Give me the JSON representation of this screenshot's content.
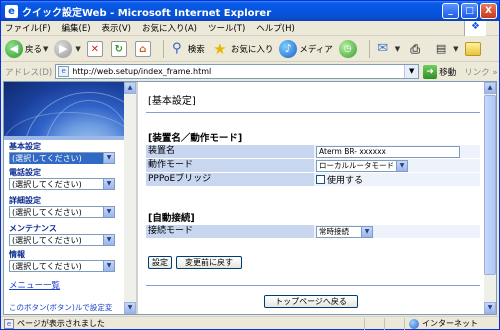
{
  "window": {
    "title": "クイック設定Web - Microsoft Internet Explorer",
    "buttons": {
      "minimize": "_",
      "maximize": "□",
      "close": "X"
    }
  },
  "menubar": {
    "items": [
      "ファイル(F)",
      "編集(E)",
      "表示(V)",
      "お気に入り(A)",
      "ツール(T)",
      "ヘルプ(H)"
    ]
  },
  "toolbar": {
    "back_label": "戻る",
    "search_label": "検索",
    "favorites_label": "お気に入り",
    "media_label": "メディア"
  },
  "addressbar": {
    "label": "アドレス(D)",
    "url": "http://web.setup/index_frame.html",
    "go_label": "移動",
    "links_label": "リンク"
  },
  "sidebar": {
    "sections": [
      {
        "heading": "基本設定",
        "selected": "(選択してください)",
        "active": true
      },
      {
        "heading": "電話設定",
        "selected": "(選択してください)",
        "active": false
      },
      {
        "heading": "詳細設定",
        "selected": "(選択してください)",
        "active": false
      },
      {
        "heading": "メンテナンス",
        "selected": "(選択してください)",
        "active": false
      },
      {
        "heading": "情報",
        "selected": "(選択してください)",
        "active": false
      }
    ],
    "menu_list_label": "メニュー一覧",
    "bottom_link": "このボタン(ボタン)ルで設定変"
  },
  "main": {
    "page_title": "[基本設定]",
    "device_section": {
      "title": "[装置名／動作モード]",
      "device_name_label": "装置名",
      "device_name_value": "Aterm BR- xxxxxx",
      "mode_label": "動作モード",
      "mode_value": "ローカルルータモード",
      "pppoe_label": "PPPoEブリッジ",
      "pppoe_checkbox_label": "使用する"
    },
    "auto_section": {
      "title": "[自動接続]",
      "conn_mode_label": "接続モード",
      "conn_mode_value": "常時接続"
    },
    "set_button": "設定",
    "revert_button": "変更前に戻す",
    "top_page_button": "トップページへ戻る"
  },
  "statusbar": {
    "message": "ページが表示されました",
    "zone": "インターネット"
  }
}
